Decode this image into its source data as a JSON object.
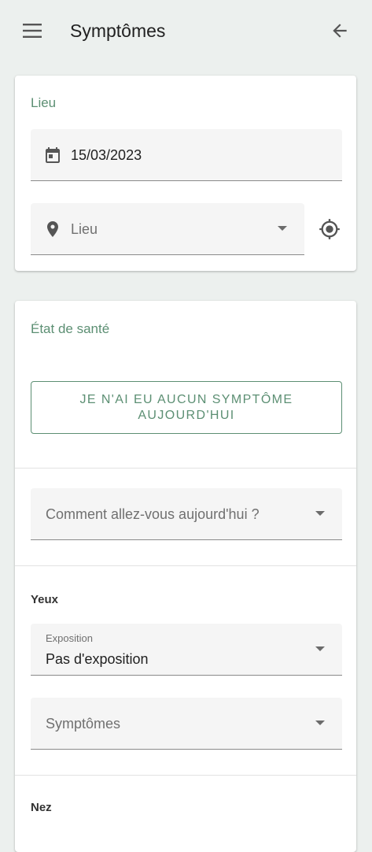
{
  "app_bar": {
    "title": "Symptômes",
    "menu_icon": "menu-icon",
    "back_icon": "arrow-back-icon"
  },
  "lieu_card": {
    "title": "Lieu",
    "date_field": {
      "icon": "calendar-icon",
      "value": "15/03/2023"
    },
    "location_field": {
      "icon": "location-pin-icon",
      "placeholder": "Lieu"
    },
    "gps_button_icon": "my-location-icon"
  },
  "sante_card": {
    "title": "État de santé",
    "no_symptom_button": "JE N'AI EU AUCUN SYMPTÔME AUJOURD'HUI",
    "mood_select": {
      "placeholder": "Comment allez-vous aujourd'hui ?"
    },
    "yeux": {
      "label": "Yeux",
      "exposition": {
        "label": "Exposition",
        "value": "Pas d'exposition"
      },
      "symptomes": {
        "placeholder": "Symptômes"
      }
    },
    "next_group_label": "Nez"
  },
  "colors": {
    "accent": "#5c8f73",
    "background": "#ecf0ee",
    "field_bg": "#f5f5f5"
  }
}
